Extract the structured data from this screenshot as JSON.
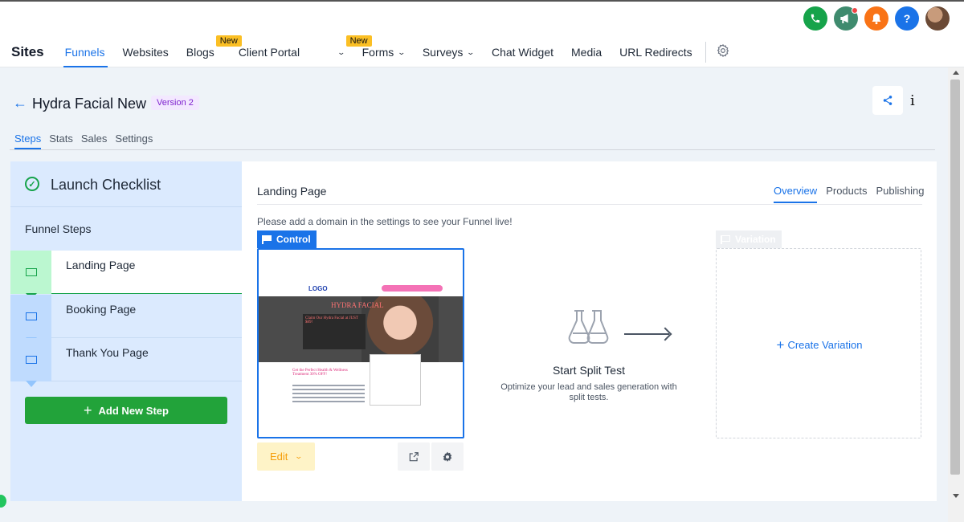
{
  "nav": {
    "section_title": "Sites",
    "items": [
      {
        "label": "Funnels",
        "active": true
      },
      {
        "label": "Websites"
      },
      {
        "label": "Blogs",
        "badge": "New"
      },
      {
        "label": "Client Portal",
        "badge": "New",
        "dropdown": true
      },
      {
        "label": "Forms",
        "dropdown": true
      },
      {
        "label": "Surveys",
        "dropdown": true
      },
      {
        "label": "Chat Widget"
      },
      {
        "label": "Media"
      },
      {
        "label": "URL Redirects"
      }
    ]
  },
  "header_icons": [
    "phone-icon",
    "megaphone-icon",
    "bell-icon",
    "help-icon",
    "avatar"
  ],
  "help_glyph": "?",
  "funnel": {
    "title": "Hydra Facial New",
    "version": "Version 2"
  },
  "subtabs": [
    "Steps",
    "Stats",
    "Sales",
    "Settings"
  ],
  "sidebar": {
    "checklist_title": "Launch Checklist",
    "steps_heading": "Funnel Steps",
    "steps": [
      {
        "label": "Landing Page",
        "active": true
      },
      {
        "label": "Booking Page"
      },
      {
        "label": "Thank You Page"
      }
    ],
    "add_step_label": "Add New Step"
  },
  "main": {
    "title": "Landing Page",
    "tabs": [
      "Overview",
      "Products",
      "Publishing"
    ],
    "active_tab": "Overview",
    "domain_note": "Please add a domain in the settings to see your Funnel live!",
    "control_label": "Control",
    "variation_label": "Variation",
    "edit_label": "Edit",
    "split_title": "Start Split Test",
    "split_desc": "Optimize your lead and sales generation with split tests.",
    "create_variation_label": "Create Variation",
    "thumbnail": {
      "logo": "LOGO",
      "brand": "HYDRA FACIAL",
      "offer": "Claim Our Hydra Facial at JUST $89!",
      "headline": "Get the Perfect Health & Wellness Treatment 30% OFF!"
    }
  },
  "colors": {
    "accent": "#1a73e8",
    "primary_green": "#22a33a",
    "sidebar_bg": "#dbeafe",
    "badge_yellow": "#fbbf24",
    "version_purple": "#7e22ce"
  }
}
